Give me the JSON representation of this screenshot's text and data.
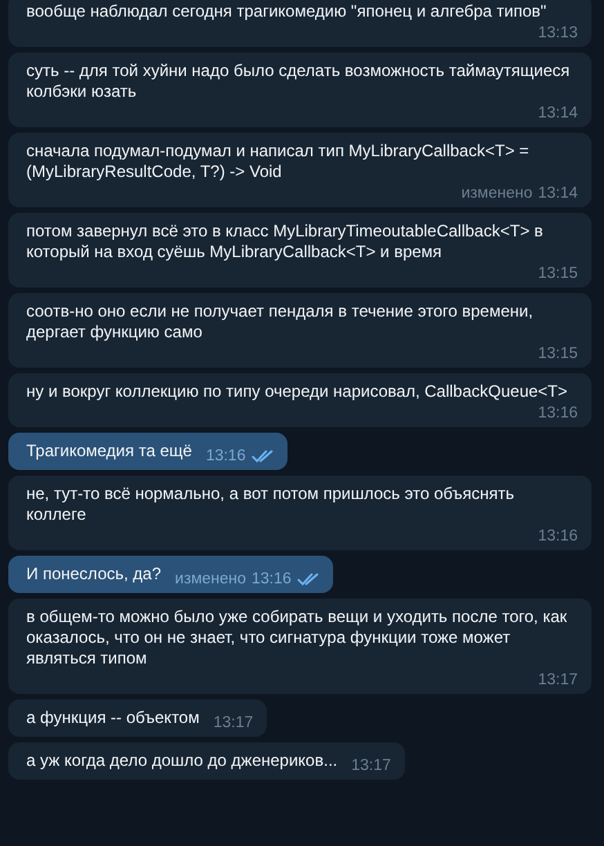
{
  "messages": [
    {
      "text": "вообще наблюдал сегодня трагикомедию \"японец и алгебра типов\"",
      "time": "13:13",
      "outgoing": false
    },
    {
      "text": "суть -- для той хуйни надо было сделать возможность таймаутящиеся колбэки юзать",
      "time": "13:14",
      "outgoing": false
    },
    {
      "text": "сначала подумал-подумал и написал тип MyLibraryCallback<T> = (MyLibraryResultCode, T?) -> Void",
      "time": "13:14",
      "edited": "изменено",
      "outgoing": false
    },
    {
      "text": "потом завернул всё это в класс MyLibraryTimeoutableCallback<T> в который на вход суёшь MyLibraryCallback<T> и время",
      "time": "13:15",
      "outgoing": false
    },
    {
      "text": "соотв-но оно если не получает пендаля в течение этого времени, дергает функцию само",
      "time": "13:15",
      "outgoing": false
    },
    {
      "text": "ну и вокруг коллекцию по типу очереди нарисовал, CallbackQueue<T>",
      "time": "13:16",
      "outgoing": false
    },
    {
      "text": "Трагикомедия та ещё",
      "time": "13:16",
      "outgoing": true,
      "read": true
    },
    {
      "text": "не, тут-то всё нормально, а вот потом пришлось это объяснять коллеге",
      "time": "13:16",
      "outgoing": false
    },
    {
      "text": "И понеслось, да?",
      "time": "13:16",
      "edited": "изменено",
      "outgoing": true,
      "read": true
    },
    {
      "text": "в общем-то можно было уже собирать вещи и уходить после того, как оказалось, что он не знает, что сигнатура функции тоже может являться типом",
      "time": "13:17",
      "outgoing": false
    },
    {
      "text": "а функция -- объектом",
      "time": "13:17",
      "outgoing": false
    },
    {
      "text": "а уж когда дело дошло до дженериков...",
      "time": "13:17",
      "outgoing": false
    }
  ]
}
